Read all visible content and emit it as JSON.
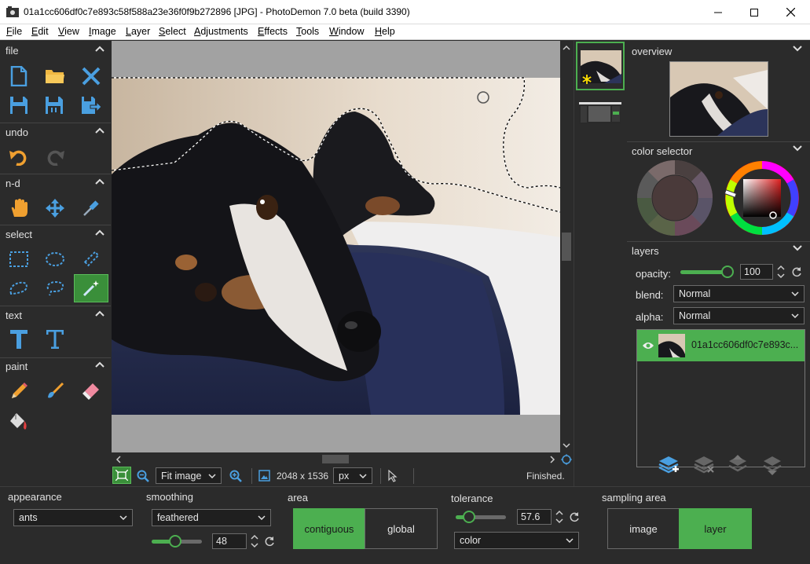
{
  "window": {
    "title": "01a1cc606df0c7e893c58f588a23e36f0f9b272896 [JPG]  -  PhotoDemon 7.0 beta (build 3390)",
    "minimize_icon": "minimize-icon",
    "maximize_icon": "maximize-icon",
    "close_icon": "close-icon"
  },
  "menu": [
    "File",
    "Edit",
    "View",
    "Image",
    "Layer",
    "Select",
    "Adjustments",
    "Effects",
    "Tools",
    "Window",
    "Help"
  ],
  "toolbox": {
    "sections": {
      "file": "file",
      "undo": "undo",
      "nd": "n-d",
      "select": "select",
      "text": "text",
      "paint": "paint"
    },
    "active_tool": "magic-wand-icon"
  },
  "canvas": {
    "zoom": "Fit image",
    "dimensions": "2048 x 1536",
    "unit": "px",
    "status": "Finished."
  },
  "right_panel": {
    "overview": "overview",
    "color_selector": "color selector",
    "layers": "layers",
    "opacity_label": "opacity:",
    "opacity_value": "100",
    "blend_label": "blend:",
    "blend_value": "Normal",
    "alpha_label": "alpha:",
    "alpha_value": "Normal",
    "layer_name": "01a1cc606df0c7e893c...",
    "accent_color": "#4caf50"
  },
  "options": {
    "appearance_label": "appearance",
    "appearance_value": "ants",
    "smoothing_label": "smoothing",
    "smoothing_value": "feathered",
    "smoothing_amount": "48",
    "area_label": "area",
    "area_contiguous": "contiguous",
    "area_global": "global",
    "tolerance_label": "tolerance",
    "tolerance_value": "57.6",
    "tolerance_mode": "color",
    "sampling_label": "sampling area",
    "sampling_image": "image",
    "sampling_layer": "layer"
  }
}
